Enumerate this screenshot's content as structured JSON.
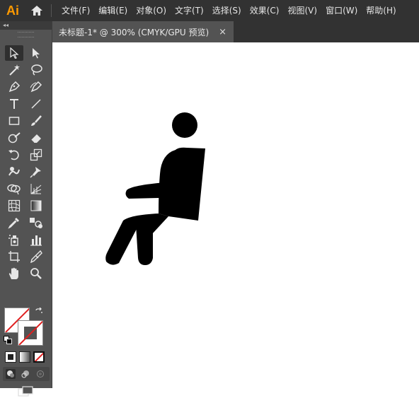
{
  "app": {
    "logo": "Ai"
  },
  "menu": [
    "文件(F)",
    "编辑(E)",
    "对象(O)",
    "文字(T)",
    "选择(S)",
    "效果(C)",
    "视图(V)",
    "窗口(W)",
    "帮助(H)"
  ],
  "document_tab": {
    "title": "未标题-1* @ 300% (CMYK/GPU 预览)",
    "close": "×"
  },
  "toolbar": {
    "collapse_label": "◂◂"
  },
  "colors": {
    "brand": "#ff9a00",
    "ui_dark": "#323232",
    "ui_mid": "#535353",
    "none_slash": "#e02020",
    "artwork": "#000000"
  },
  "tools": [
    "selection-tool",
    "direct-selection-tool",
    "magic-wand-tool",
    "lasso-tool",
    "pen-tool",
    "curvature-tool",
    "type-tool",
    "line-segment-tool",
    "rectangle-tool",
    "paintbrush-tool",
    "shaper-tool",
    "eraser-tool",
    "rotate-tool",
    "scale-tool",
    "warp-tool",
    "puppet-warp-tool",
    "shape-builder-tool",
    "perspective-grid-tool",
    "mesh-tool",
    "gradient-tool",
    "eyedropper-tool",
    "blend-tool",
    "symbol-sprayer-tool",
    "column-graph-tool",
    "artboard-tool",
    "slice-tool",
    "hand-tool",
    "zoom-tool"
  ]
}
